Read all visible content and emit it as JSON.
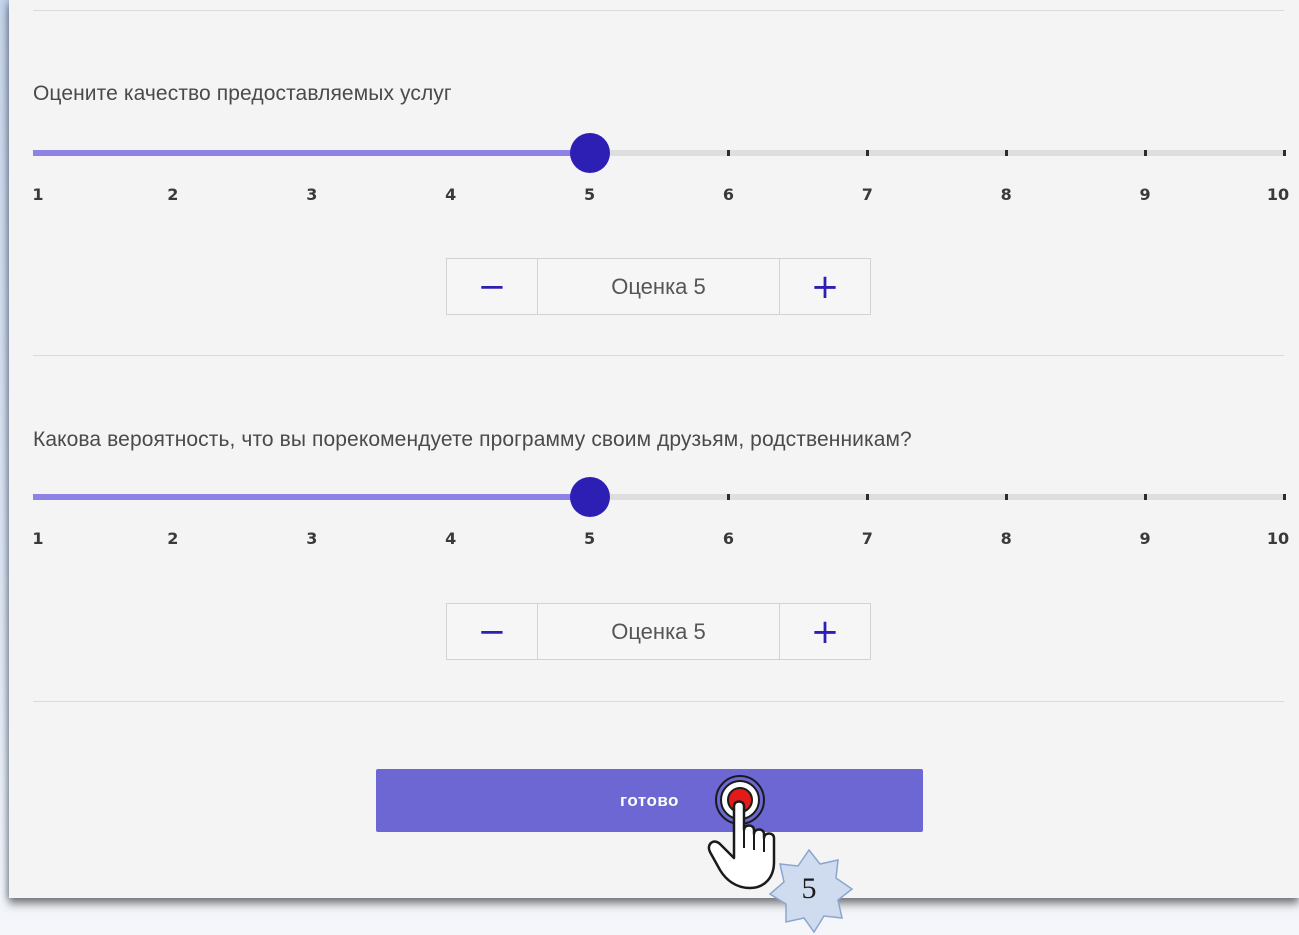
{
  "questions": [
    {
      "text": "Оцените качество предоставляемых услуг",
      "min": 1,
      "max": 10,
      "value": 5,
      "scale_labels": [
        "1",
        "2",
        "3",
        "4",
        "5",
        "6",
        "7",
        "8",
        "9",
        "10"
      ],
      "stepper": {
        "minus": "−",
        "value_text": "Оценка 5",
        "plus": "+"
      }
    },
    {
      "text": "Какова вероятность, что вы порекомендуете программу своим друзьям, родственникам?",
      "min": 1,
      "max": 10,
      "value": 5,
      "scale_labels": [
        "1",
        "2",
        "3",
        "4",
        "5",
        "6",
        "7",
        "8",
        "9",
        "10"
      ],
      "stepper": {
        "minus": "−",
        "value_text": "Оценка 5",
        "plus": "+"
      }
    }
  ],
  "submit": {
    "label": "готово"
  },
  "annotation": {
    "step_number": "5"
  },
  "colors": {
    "accent": "#2e1fb4",
    "track_fill": "#8c83e4",
    "button": "#6d67d3",
    "click_marker": "#e21a1a"
  }
}
